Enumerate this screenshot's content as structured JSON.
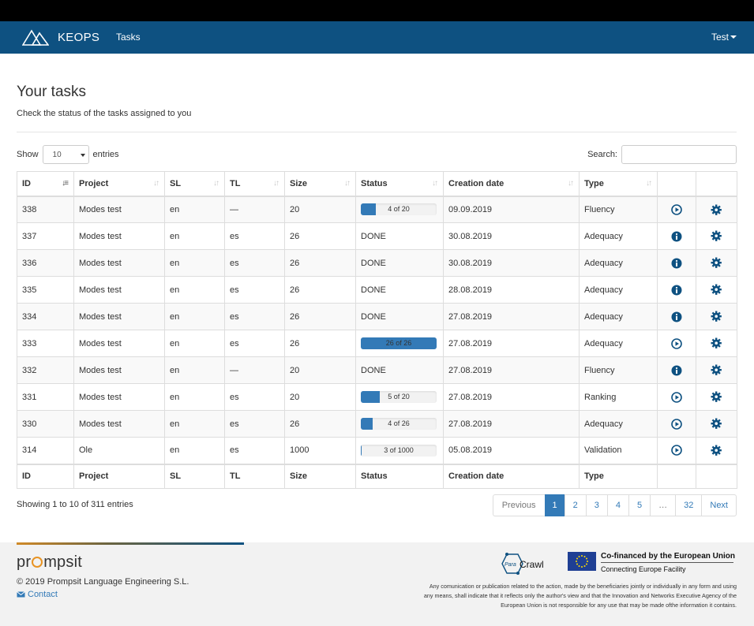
{
  "navbar": {
    "brand": "KEOPS",
    "tasks_link": "Tasks",
    "user": "Test"
  },
  "page": {
    "title": "Your tasks",
    "subtitle": "Check the status of the tasks assigned to you"
  },
  "controls": {
    "show_label": "Show",
    "page_length": "10",
    "entries_label": "entries",
    "search_label": "Search:",
    "search_value": ""
  },
  "table": {
    "headers": [
      "ID",
      "Project",
      "SL",
      "TL",
      "Size",
      "Status",
      "Creation date",
      "Type"
    ],
    "rows": [
      {
        "id": "338",
        "project": "Modes test",
        "sl": "en",
        "tl": "—",
        "size": "20",
        "status": "4 of 20",
        "progress": 0.2,
        "date": "09.09.2019",
        "type": "Fluency",
        "action": "play-icon"
      },
      {
        "id": "337",
        "project": "Modes test",
        "sl": "en",
        "tl": "es",
        "size": "26",
        "status": "DONE",
        "progress": null,
        "date": "30.08.2019",
        "type": "Adequacy",
        "action": "info-icon"
      },
      {
        "id": "336",
        "project": "Modes test",
        "sl": "en",
        "tl": "es",
        "size": "26",
        "status": "DONE",
        "progress": null,
        "date": "30.08.2019",
        "type": "Adequacy",
        "action": "info-icon"
      },
      {
        "id": "335",
        "project": "Modes test",
        "sl": "en",
        "tl": "es",
        "size": "26",
        "status": "DONE",
        "progress": null,
        "date": "28.08.2019",
        "type": "Adequacy",
        "action": "info-icon"
      },
      {
        "id": "334",
        "project": "Modes test",
        "sl": "en",
        "tl": "es",
        "size": "26",
        "status": "DONE",
        "progress": null,
        "date": "27.08.2019",
        "type": "Adequacy",
        "action": "info-icon"
      },
      {
        "id": "333",
        "project": "Modes test",
        "sl": "en",
        "tl": "es",
        "size": "26",
        "status": "26 of 26",
        "progress": 1.0,
        "date": "27.08.2019",
        "type": "Adequacy",
        "action": "play-icon"
      },
      {
        "id": "332",
        "project": "Modes test",
        "sl": "en",
        "tl": "—",
        "size": "20",
        "status": "DONE",
        "progress": null,
        "date": "27.08.2019",
        "type": "Fluency",
        "action": "info-icon"
      },
      {
        "id": "331",
        "project": "Modes test",
        "sl": "en",
        "tl": "es",
        "size": "20",
        "status": "5 of 20",
        "progress": 0.25,
        "date": "27.08.2019",
        "type": "Ranking",
        "action": "play-icon"
      },
      {
        "id": "330",
        "project": "Modes test",
        "sl": "en",
        "tl": "es",
        "size": "26",
        "status": "4 of 26",
        "progress": 0.154,
        "date": "27.08.2019",
        "type": "Adequacy",
        "action": "play-icon"
      },
      {
        "id": "314",
        "project": "Ole",
        "sl": "en",
        "tl": "es",
        "size": "1000",
        "status": "3 of 1000",
        "progress": 0.003,
        "date": "05.08.2019",
        "type": "Validation",
        "action": "play-icon"
      }
    ]
  },
  "info": "Showing 1 to 10 of 311 entries",
  "pagination": {
    "previous": "Previous",
    "pages": [
      "1",
      "2",
      "3",
      "4",
      "5",
      "…",
      "32"
    ],
    "active": "1",
    "next": "Next"
  },
  "footer": {
    "copyright": "2019 Prompsit Language Engineering S.L.",
    "contact": "Contact",
    "eu_line1": "Co-financed by the European Union",
    "eu_line2": "Connecting Europe Facility",
    "disclaimer": "Any comunication or publication related to the action, made by the beneficiaries jointly or individually in any form and using any means, shall indicate that it reflects only the author's view and that the Innovation and Networks Executive Agency of the European Union is not responsible for any use that may be made ofthe information it contains.",
    "logo_text": "prompsit",
    "paracrawl_text": "ParaCrawl"
  },
  "colors": {
    "navbar": "#0e5181",
    "primary": "#337ab7",
    "accent_orange": "#e89323"
  }
}
